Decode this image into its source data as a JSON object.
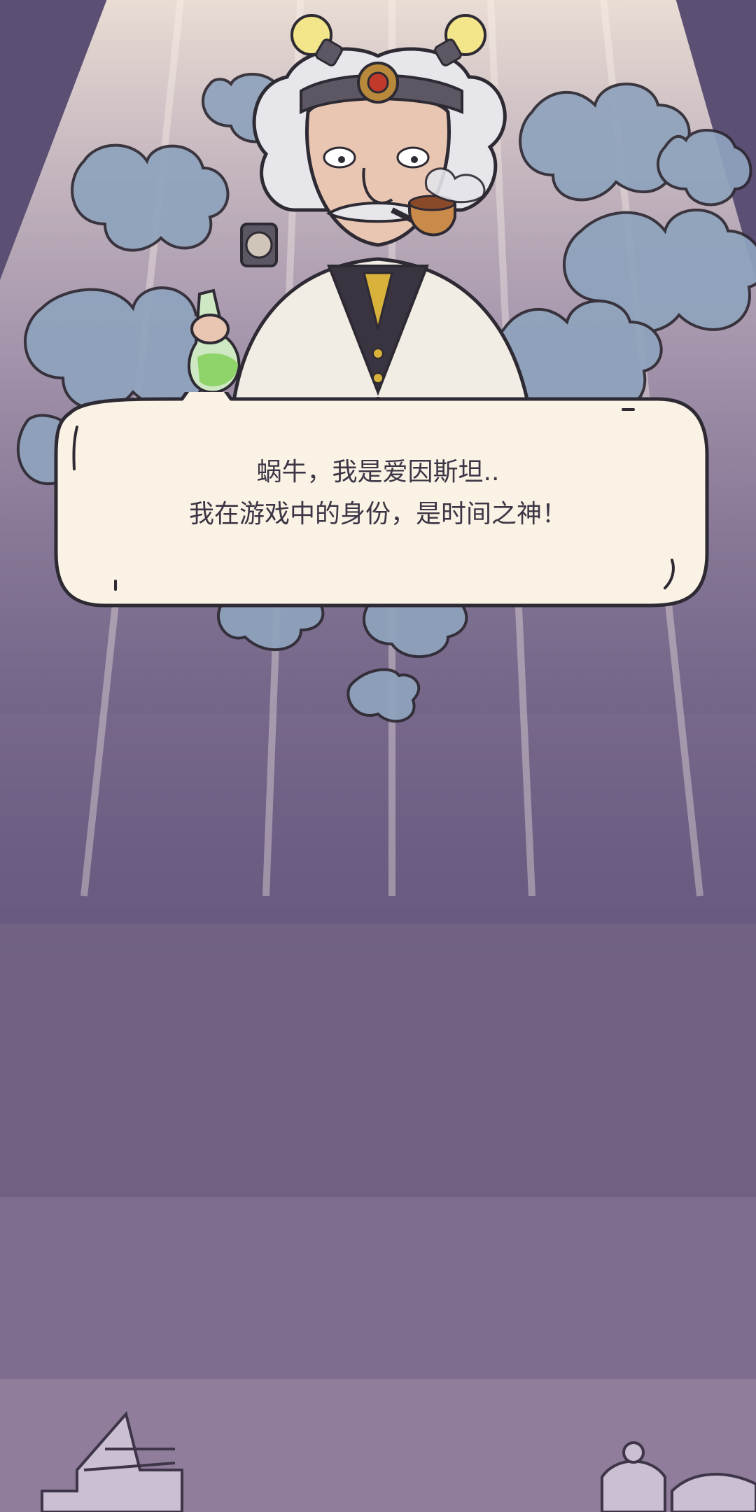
{
  "dialogue": {
    "line1": "蜗牛，我是爱因斯坦..",
    "line2": "我在游戏中的身份，是时间之神！"
  },
  "colors": {
    "background_dark": "#5b4f73",
    "background_light": "#907d9c",
    "smoke": "#8fa3bd",
    "bubble_fill": "#faf3e5",
    "bubble_outline": "#2e2a33",
    "text": "#3b3545",
    "tie": "#d8b23a",
    "flask_liquid": "#8fd46a"
  },
  "icons": {
    "character": "einstein-time-god",
    "headlamp": "light-bulb-icon",
    "pipe": "smoking-pipe-icon",
    "flask": "flask-icon",
    "skyline": "city-skyline"
  }
}
